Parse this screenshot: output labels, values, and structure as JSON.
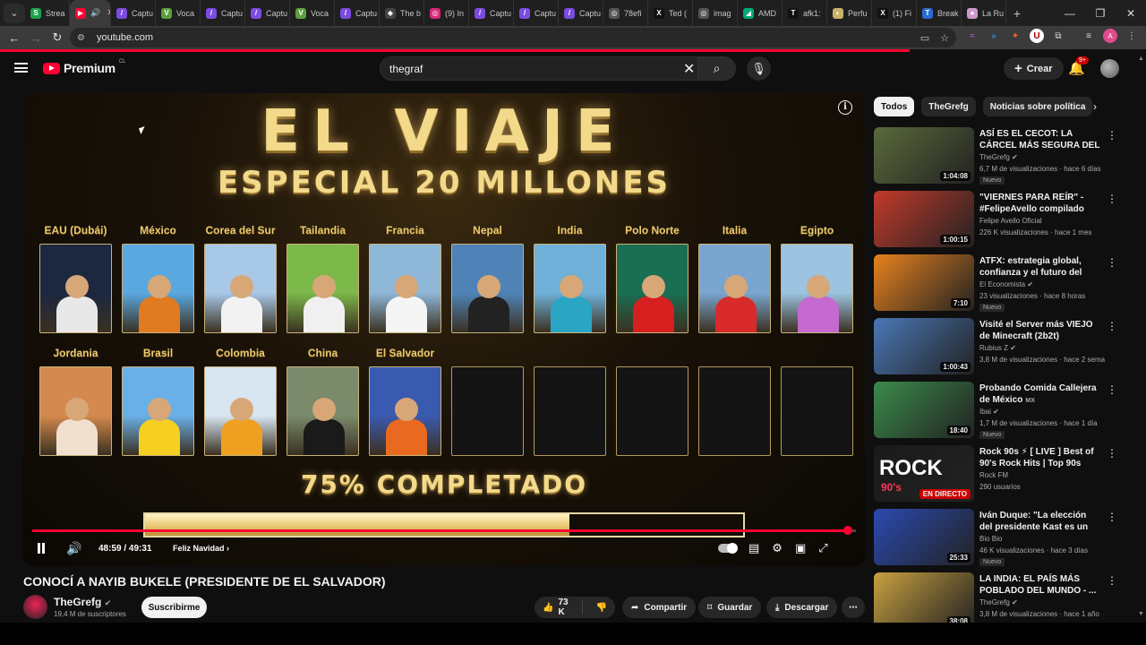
{
  "browser": {
    "tabs": [
      {
        "label": "Strea",
        "color": "#1ca34a",
        "glyph": "S"
      },
      {
        "label": "",
        "color": "#ff0033",
        "glyph": "▶",
        "active": true
      },
      {
        "label": "Captu",
        "color": "#7a4ce0",
        "glyph": "/"
      },
      {
        "label": "Voca",
        "color": "#5c9f3f",
        "glyph": "V"
      },
      {
        "label": "Captu",
        "color": "#7a4ce0",
        "glyph": "/"
      },
      {
        "label": "Captu",
        "color": "#7a4ce0",
        "glyph": "/"
      },
      {
        "label": "Voca",
        "color": "#5c9f3f",
        "glyph": "V"
      },
      {
        "label": "Captu",
        "color": "#7a4ce0",
        "glyph": "/"
      },
      {
        "label": "The b",
        "color": "#444",
        "glyph": "◆"
      },
      {
        "label": "(9) In",
        "color": "#d62976",
        "glyph": "◎"
      },
      {
        "label": "Captu",
        "color": "#7a4ce0",
        "glyph": "/"
      },
      {
        "label": "Captu",
        "color": "#7a4ce0",
        "glyph": "/"
      },
      {
        "label": "Captu",
        "color": "#7a4ce0",
        "glyph": "/"
      },
      {
        "label": "78efi",
        "color": "#555",
        "glyph": "◎"
      },
      {
        "label": "Ted (",
        "color": "#111",
        "glyph": "X"
      },
      {
        "label": "imag",
        "color": "#555",
        "glyph": "◎"
      },
      {
        "label": "AMD",
        "color": "#0a7",
        "glyph": "◢"
      },
      {
        "label": "afk1:",
        "color": "#111",
        "glyph": "T"
      },
      {
        "label": "Perfu",
        "color": "#c9b26a",
        "glyph": "◐"
      },
      {
        "label": "(1) Fi",
        "color": "#111",
        "glyph": "X"
      },
      {
        "label": "Break",
        "color": "#2a6bd1",
        "glyph": "T"
      },
      {
        "label": "La Ru",
        "color": "#c9c",
        "glyph": "●"
      }
    ],
    "address": "youtube.com"
  },
  "masthead": {
    "logo_text": "Premium",
    "logo_country": "CL",
    "search_value": "thegraf",
    "create_label": "Crear",
    "notif_badge": "9+"
  },
  "video": {
    "title_text": "EL VIAJE",
    "subtitle_text": "ESPECIAL 20 MILLONES",
    "countries_row1": [
      {
        "name": "EAU (Dubái)",
        "sky": "#1c2740",
        "shirt": "#e8e8e8"
      },
      {
        "name": "México",
        "sky": "#5aa8e0",
        "shirt": "#e07b22"
      },
      {
        "name": "Corea del Sur",
        "sky": "#a8c8e8",
        "shirt": "#f2f2f2"
      },
      {
        "name": "Tailandia",
        "sky": "#7cb84a",
        "shirt": "#f0f0f0"
      },
      {
        "name": "Francia",
        "sky": "#8fb7d8",
        "shirt": "#f5f5f5"
      },
      {
        "name": "Nepal",
        "sky": "#4f83b8",
        "shirt": "#222"
      },
      {
        "name": "India",
        "sky": "#6fb0d8",
        "shirt": "#2aa6c4"
      },
      {
        "name": "Polo Norte",
        "sky": "#1a6e52",
        "shirt": "#d62020"
      },
      {
        "name": "Italia",
        "sky": "#7aa5cf",
        "shirt": "#d82a2a"
      },
      {
        "name": "Egipto",
        "sky": "#9cc3e0",
        "shirt": "#c46ad0"
      }
    ],
    "countries_row2": [
      {
        "name": "Jordania",
        "sky": "#d48a4e",
        "shirt": "#f0e0d0"
      },
      {
        "name": "Brasil",
        "sky": "#6ab0e8",
        "shirt": "#f5d020"
      },
      {
        "name": "Colombia",
        "sky": "#d8e6f2",
        "shirt": "#f0a020"
      },
      {
        "name": "China",
        "sky": "#7a8a6a",
        "shirt": "#1a1a1a"
      },
      {
        "name": "El Salvador",
        "sky": "#3a5ab0",
        "shirt": "#e86a20"
      },
      {
        "name": "",
        "empty": true
      },
      {
        "name": "",
        "empty": true
      },
      {
        "name": "",
        "empty": true
      },
      {
        "name": "",
        "empty": true
      },
      {
        "name": "",
        "empty": true
      }
    ],
    "progress_text": "75% COMPLETADO",
    "progress_fraction": 0.71,
    "playback_fraction": 0.99,
    "time_current": "48:59",
    "time_total": "49:31",
    "chapter": "Feliz Navidad",
    "page_title": "CONOCÍ A NAYIB BUKELE (PRESIDENTE DE EL SALVADOR)"
  },
  "channel": {
    "name": "TheGrefg",
    "subscribers": "19,4 M de suscriptores",
    "subscribe_label": "Suscribirme"
  },
  "actions": {
    "likes": "73 K",
    "share": "Compartir",
    "save": "Guardar",
    "download": "Descargar"
  },
  "chips": [
    "Todos",
    "TheGrefg",
    "Noticias sobre política",
    "D"
  ],
  "recommendations": [
    {
      "title": "ASÍ ES EL CECOT: LA CÁRCEL MÁS SEGURA DEL MUNDO",
      "channel": "TheGrefg",
      "verified": true,
      "meta": "6,7 M de visualizaciones · hace 6 días",
      "badge": "Nuevo",
      "duration": "1:04:08",
      "bg": "#5a6a3a"
    },
    {
      "title": "\"VIERNES PARA REÍR\" - #FelipeAvello compilado 2025",
      "channel": "Felipe Avello Oficial",
      "verified": false,
      "meta": "226 K visualizaciones · hace 1 mes",
      "badge": "",
      "duration": "1:00:15",
      "bg": "#c23a2a"
    },
    {
      "title": "ATFX: estrategia global, confianza y el futuro del trading",
      "channel": "El Economista",
      "verified": true,
      "meta": "23 visualizaciones · hace 8 horas",
      "badge": "Nuevo",
      "duration": "7:10",
      "bg": "#e8821e"
    },
    {
      "title": "Visité el Server más VIEJO de Minecraft (2b2t)",
      "channel": "Rubius Z",
      "verified": true,
      "meta": "3,8 M de visualizaciones · hace 2 semanas",
      "badge": "",
      "duration": "1:00:43",
      "bg": "#4a78b8"
    },
    {
      "title": "Probando Comida Callejera de México",
      "title_suffix": "MX",
      "channel": "Ibai",
      "verified": true,
      "meta": "1,7 M de visualizaciones · hace 1 día",
      "badge": "Nuevo",
      "duration": "18:40",
      "bg": "#3a8a4a"
    },
    {
      "title": "Rock 90s ⚡ [ LIVE ] Best of 90's Rock Hits | Top 90s Rock ...",
      "channel": "Rock FM",
      "verified": false,
      "meta": "290 usuarios",
      "badge": "",
      "duration": "",
      "live": "EN DIRECTO",
      "thumb_text": "ROCK",
      "thumb_sub": "90's",
      "bg": "#1a1a1a"
    },
    {
      "title": "Iván Duque: \"La elección del presidente Kast es un gran ...",
      "channel": "Bio Bio",
      "verified": false,
      "meta": "46 K visualizaciones · hace 3 días",
      "badge": "Nuevo",
      "duration": "25:33",
      "bg": "#2a4ab0"
    },
    {
      "title": "LA INDIA: EL PAÍS MÁS POBLADO DEL MUNDO - ...",
      "channel": "TheGrefg",
      "verified": true,
      "meta": "3,8 M de visualizaciones · hace 1 año",
      "badge": "",
      "duration": "38:08",
      "bg": "#c8a040"
    }
  ],
  "colors": {
    "accent": "#ff0033",
    "gold": "#f3d98a"
  }
}
